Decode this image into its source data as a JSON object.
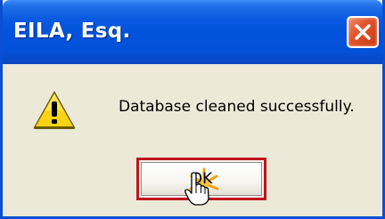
{
  "dialog": {
    "title": "EILA, Esq.",
    "message": "Database cleaned successfully.",
    "ok_label": "OK",
    "icons": {
      "warning": "warning-icon",
      "close": "close-icon",
      "cursor": "hand-pointer-icon"
    }
  },
  "colors": {
    "titlebar": "#0052dc",
    "dialog_bg": "#ece9d8",
    "close_button": "#e2552c",
    "ok_focus_border": "#c0141c",
    "warning_fill": "#f8d214"
  }
}
